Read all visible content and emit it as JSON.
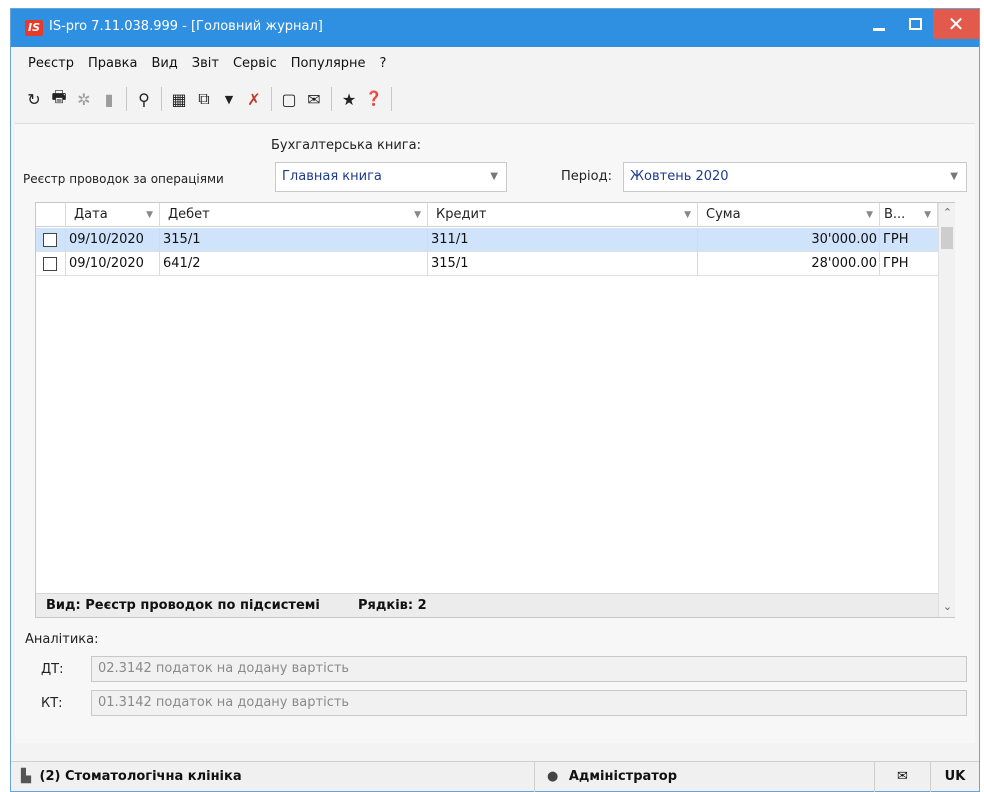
{
  "window": {
    "title": "IS-pro 7.11.038.999 - [Головний журнал]",
    "logo_text": "IS",
    "close_glyph": "✕"
  },
  "menu": [
    "Реєстр",
    "Правка",
    "Вид",
    "Звіт",
    "Сервіс",
    "Популярне",
    "?"
  ],
  "toolbar": {
    "icons": [
      {
        "name": "refresh-icon",
        "glyph": "↻"
      },
      {
        "name": "print-icon",
        "glyph": "🖶"
      },
      {
        "name": "create-icon",
        "glyph": "✲"
      },
      {
        "name": "disabled-action-icon",
        "glyph": "▮"
      },
      {
        "name": "search-icon",
        "glyph": "⚲"
      },
      {
        "name": "table-icon",
        "glyph": "▦"
      },
      {
        "name": "copy-icon",
        "glyph": "⧉"
      },
      {
        "name": "filter-icon",
        "glyph": "▼"
      },
      {
        "name": "clear-filter-icon",
        "glyph": "✗"
      },
      {
        "name": "document-icon",
        "glyph": "▢"
      },
      {
        "name": "mail-icon",
        "glyph": "✉"
      },
      {
        "name": "favorite-star-icon",
        "glyph": "★"
      },
      {
        "name": "help-icon",
        "glyph": "❓"
      }
    ]
  },
  "filters": {
    "register_label": "Реєстр проводок за операціями",
    "book_label": "Бухгалтерська книга:",
    "book_value": "Главная книга",
    "period_label": "Період:",
    "period_value": "Жовтень 2020"
  },
  "grid": {
    "columns": [
      "Дата",
      "Дебет",
      "Кредит",
      "Сума",
      "В..."
    ],
    "rows": [
      {
        "date": "09/10/2020",
        "debit": "315/1",
        "credit": "311/1",
        "amount": "30'000.00",
        "currency": "ГРН",
        "selected": true
      },
      {
        "date": "09/10/2020",
        "debit": "641/2",
        "credit": "315/1",
        "amount": "28'000.00",
        "currency": "ГРН",
        "selected": false
      }
    ],
    "footer_view": "Вид: Реєстр проводок по підсистемі",
    "footer_count": "Рядків: 2"
  },
  "analytics": {
    "label": "Аналітика:",
    "dt_label": "ДТ:",
    "dt_value": "02.3142 податок на додану вартість",
    "kt_label": "КТ:",
    "kt_value": "01.3142 податок на додану вартість"
  },
  "status": {
    "company": "(2) Стоматологічна клініка",
    "user": "Адміністратор",
    "lang": "UK"
  },
  "colors": {
    "titlebar": "#2f8fe0",
    "close": "#e25a4b",
    "selected_row": "#cfe3fb",
    "combo_text": "#1e3b8f"
  }
}
